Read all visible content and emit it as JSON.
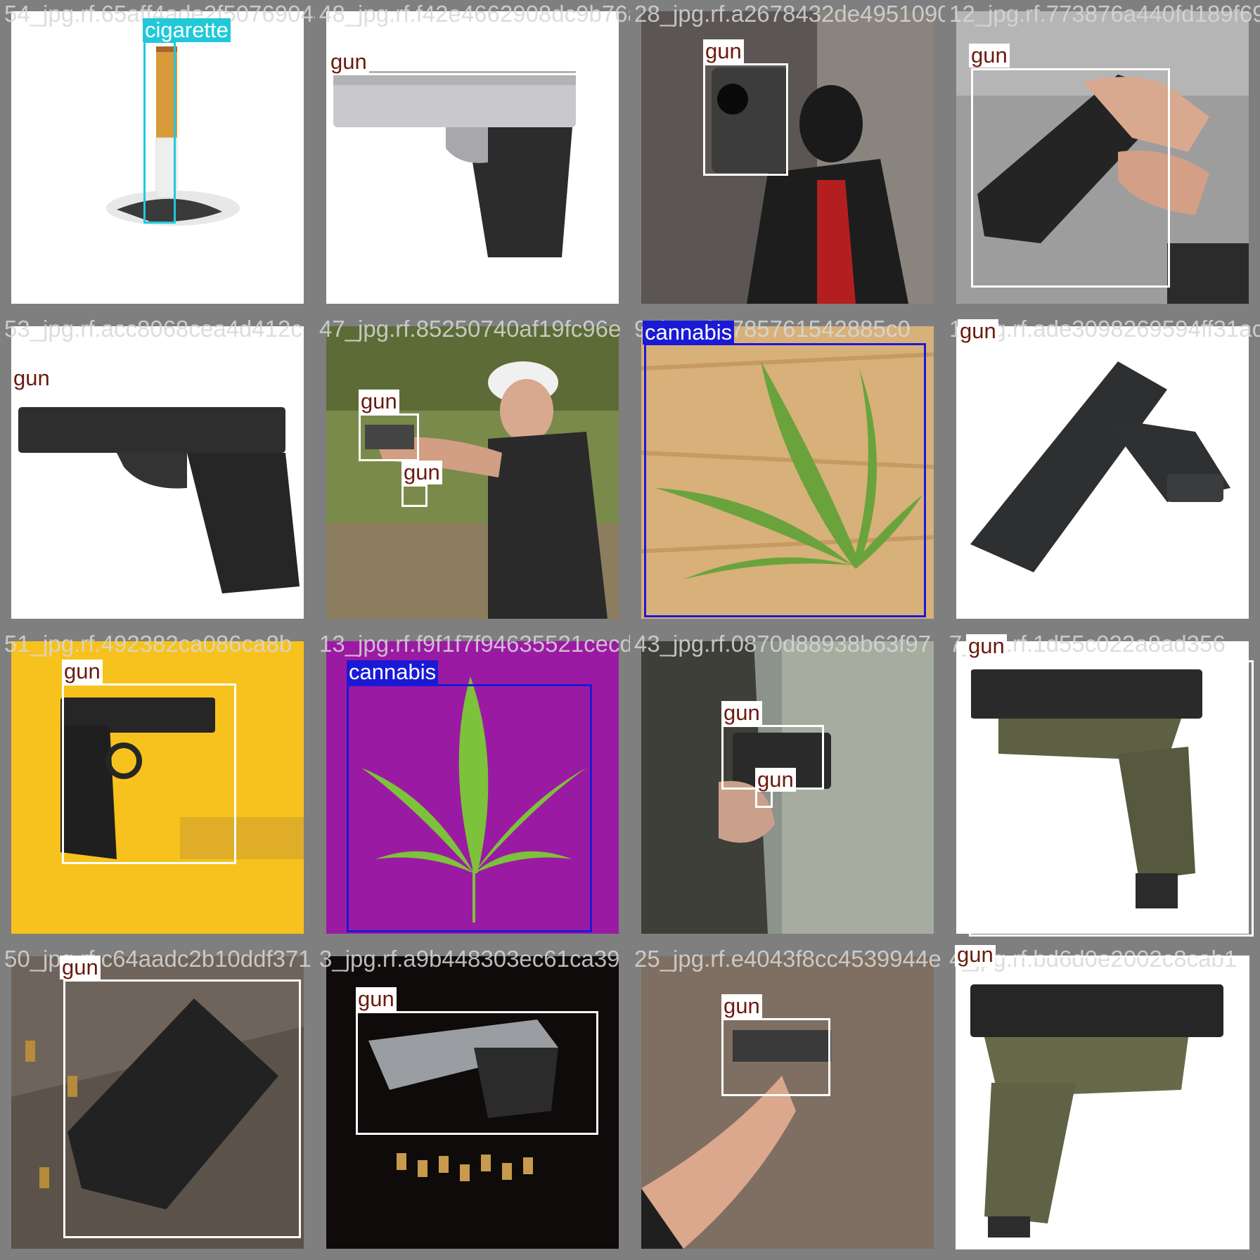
{
  "tiles": [
    {
      "file": "54_jpg.rf.65aff4ade2f50769048",
      "theme": "cigarette"
    },
    {
      "file": "48_jpg.rf.f42e4662908dc9b76a6",
      "theme": "deagle"
    },
    {
      "file": "28_jpg.rf.a2678432de495109083fad0",
      "theme": "masked"
    },
    {
      "file": "12_jpg.rf.773876a440fd189f69c",
      "theme": "hands"
    },
    {
      "file": "53_jpg.rf.acc8068cea4d412c",
      "theme": "glock"
    },
    {
      "file": "47_jpg.rf.85250740af19fc96e",
      "theme": "shooter"
    },
    {
      "file": "9_jpg.rf.0785761542885c0",
      "theme": "leaf-wood"
    },
    {
      "file": "1_jpg.rf.ade3098269594ff31ac",
      "theme": "pistol-white"
    },
    {
      "file": "51_jpg.rf.492382ca086ca8b",
      "theme": "beretta-yellow"
    },
    {
      "file": "13_jpg.rf.f9f1f7f94635521cecd7",
      "theme": "leaf-purple"
    },
    {
      "file": "43_jpg.rf.0870d88938b63f97",
      "theme": "holster"
    },
    {
      "file": "7_jpg.rf.1d55c022a8ad356",
      "theme": "green-pistol"
    },
    {
      "file": "50_jpg.rf.c64aadc2b10ddf371",
      "theme": "dark-floor"
    },
    {
      "file": "3_jpg.rf.a9b448303ec61ca39",
      "theme": "bullets"
    },
    {
      "file": "25_jpg.rf.e4043f8cc4539944e",
      "theme": "hand-grip"
    },
    {
      "file": "4_jpg.rf.bd6d0e2002c8cab1",
      "theme": "green-pistol2"
    }
  ],
  "labels": {
    "gun": "gun",
    "cigarette": "cigarette",
    "cannabis": "cannabis"
  },
  "colors": {
    "gun_box": "#ffffff",
    "gun_text": "#6b1a0f",
    "cigarette_box": "#21c9d8",
    "cannabis_box": "#1a1ad6",
    "border": "#7f7f7f"
  },
  "icons": [
    "gun-icon",
    "cigarette-icon",
    "cannabis-leaf-icon"
  ]
}
